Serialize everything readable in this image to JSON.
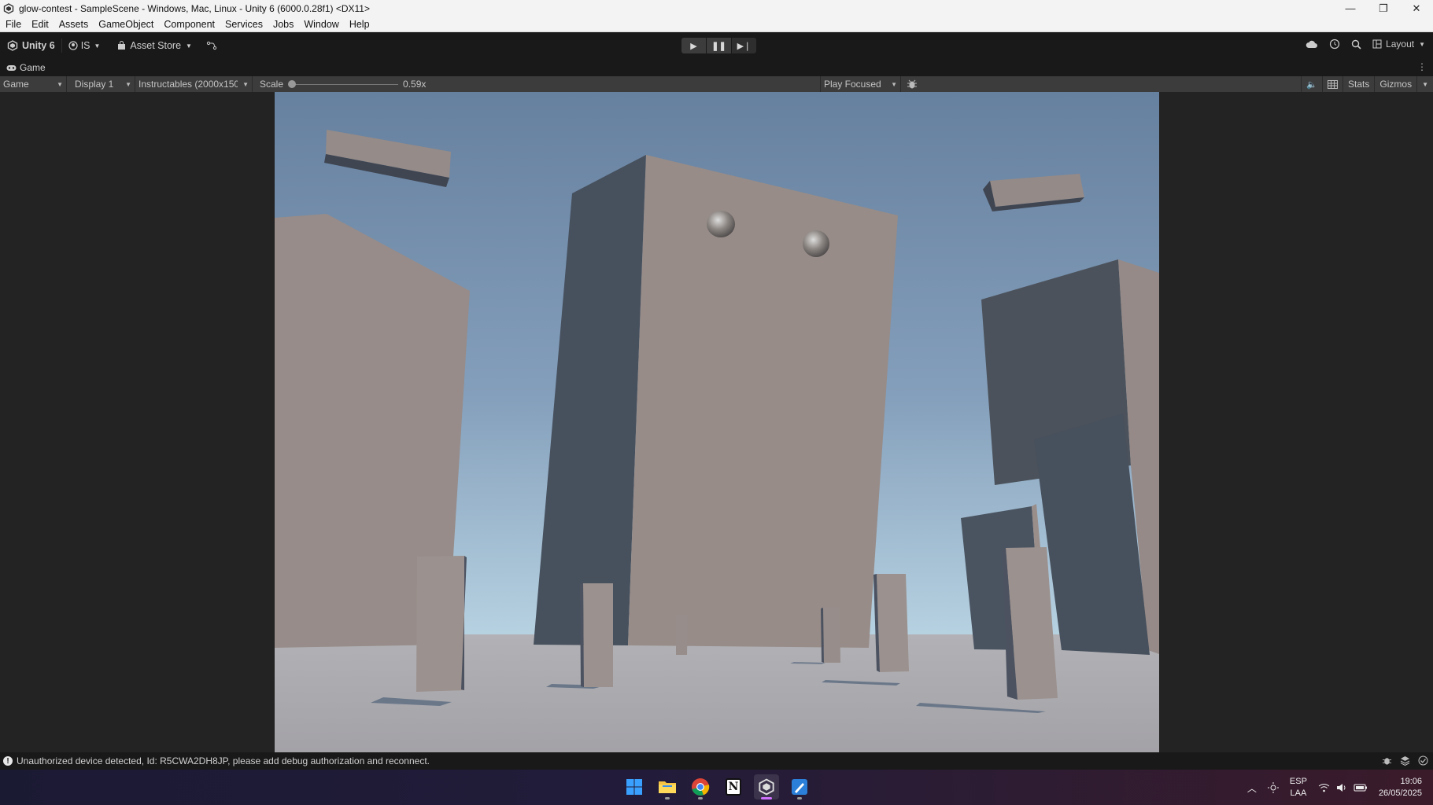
{
  "window": {
    "title": "glow-contest - SampleScene - Windows, Mac, Linux - Unity 6 (6000.0.28f1) <DX11>",
    "minimize": "—",
    "maximize": "❐",
    "close": "✕"
  },
  "menu": [
    "File",
    "Edit",
    "Assets",
    "GameObject",
    "Component",
    "Services",
    "Jobs",
    "Window",
    "Help"
  ],
  "toolbar": {
    "unity_label": "Unity 6",
    "account_label": "IS",
    "asset_store_label": "Asset Store",
    "layout_label": "Layout"
  },
  "tab": {
    "label": "Game"
  },
  "game_toolbar": {
    "view_dropdown": "Game",
    "display_dropdown": "Display 1",
    "resolution_dropdown": "Instructables (2000x150(",
    "scale_label": "Scale",
    "scale_value": "0.59x",
    "play_mode_dropdown": "Play Focused",
    "stats_label": "Stats",
    "gizmos_label": "Gizmos"
  },
  "status": {
    "message": "Unauthorized device detected, Id: R5CWA2DH8JP, please add debug authorization and reconnect."
  },
  "taskbar": {
    "apps": [
      "windows-start",
      "file-explorer",
      "chrome",
      "notion",
      "unity",
      "visual-studio"
    ],
    "notion_letter": "N",
    "lang_top": "ESP",
    "lang_bottom": "LAA",
    "time": "19:06",
    "date": "26/05/2025"
  },
  "colors": {
    "sky_top": "#66809f",
    "sky_bottom": "#a7c4d8",
    "ground": "#a9a8ad",
    "pillar_light": "#948a88",
    "pillar_shadow": "#4a5563"
  }
}
